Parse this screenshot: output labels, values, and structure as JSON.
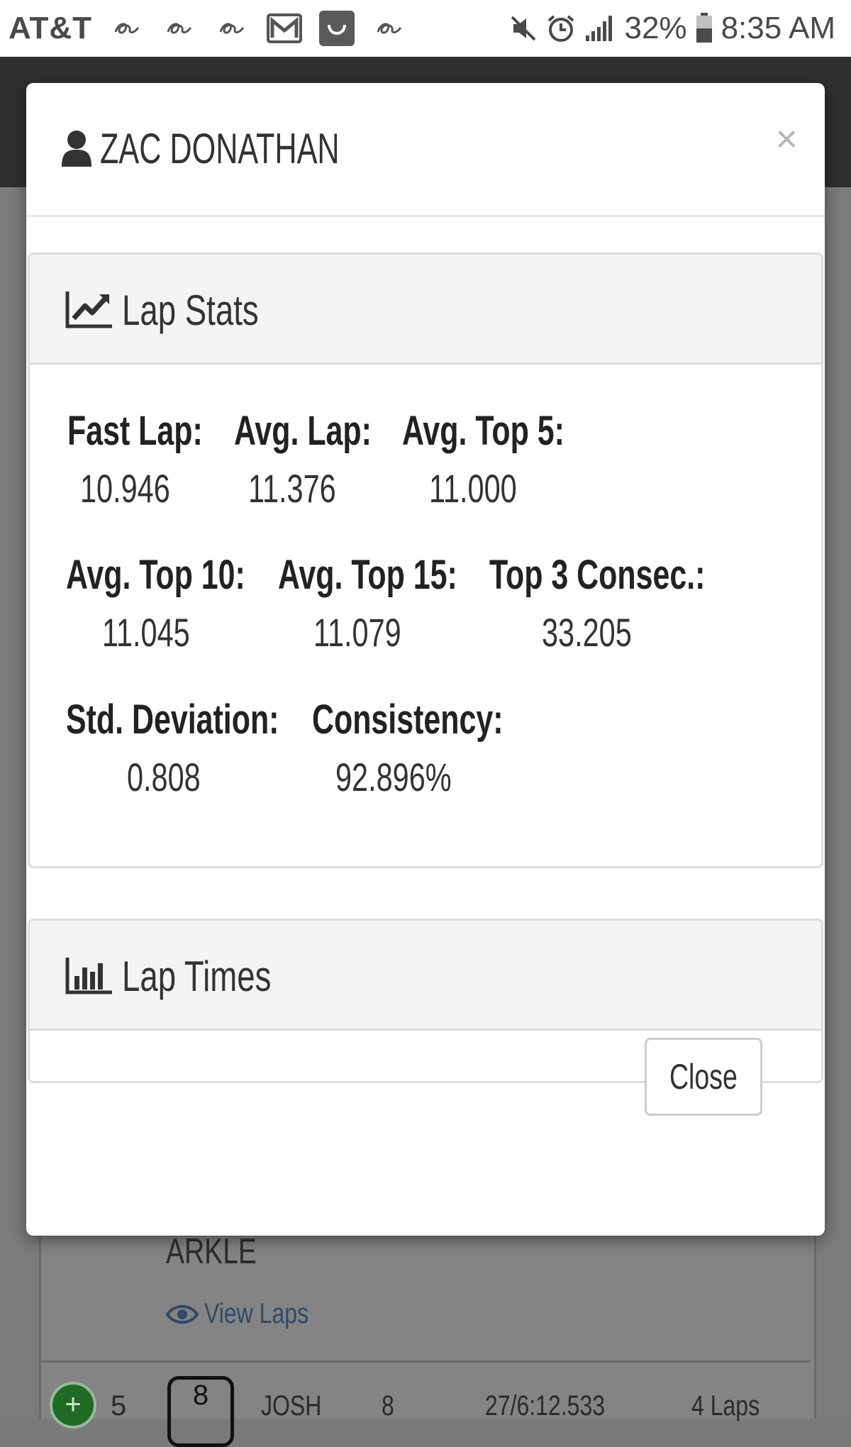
{
  "status_bar": {
    "carrier": "AT&T",
    "battery": "32%",
    "time": "8:35 AM"
  },
  "background": {
    "driver_name": "ARKLE",
    "view_laps": "View Laps",
    "next_row": {
      "rank": "5",
      "pin": "8",
      "name": "JOSH",
      "number": "8",
      "result": "27/6:12.533",
      "laps": "4 Laps"
    }
  },
  "modal": {
    "title": "ZAC DONATHAN",
    "close_icon": "×",
    "lap_stats": {
      "title": "Lap Stats",
      "stats": [
        {
          "label": "Fast Lap:",
          "value": "10.946"
        },
        {
          "label": "Avg. Lap:",
          "value": "11.376"
        },
        {
          "label": "Avg. Top 5:",
          "value": "11.000"
        },
        {
          "label": "Avg. Top 10:",
          "value": "11.045"
        },
        {
          "label": "Avg. Top 15:",
          "value": "11.079"
        },
        {
          "label": "Top 3 Consec.:",
          "value": "33.205"
        },
        {
          "label": "Std. Deviation:",
          "value": "0.808"
        },
        {
          "label": "Consistency:",
          "value": "92.896%"
        }
      ]
    },
    "lap_times": {
      "title": "Lap Times"
    },
    "close_button": "Close"
  },
  "icons": {
    "user": "user-icon",
    "line_chart": "line-chart-icon",
    "bar_chart": "bar-chart-icon",
    "eye": "eye-icon"
  }
}
